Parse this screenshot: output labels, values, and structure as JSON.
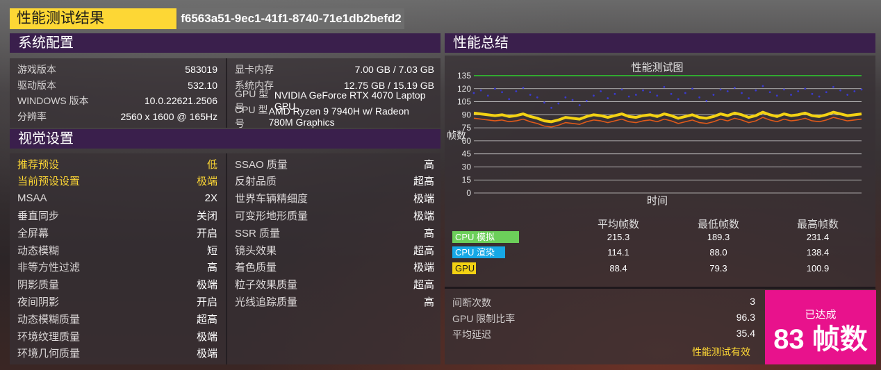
{
  "header": {
    "title": "性能测试结果",
    "run_id": "f6563a51-9ec1-41f1-8740-71e1db2befd2"
  },
  "system": {
    "title": "系统配置",
    "left": [
      {
        "label": "游戏版本",
        "value": "583019"
      },
      {
        "label": "驱动版本",
        "value": "532.10"
      },
      {
        "label": "WINDOWS 版本",
        "value": "10.0.22621.2506"
      },
      {
        "label": "分辨率",
        "value": "2560 x 1600 @ 165Hz"
      }
    ],
    "right": [
      {
        "label": "显卡内存",
        "value": "7.00 GB / 7.03 GB"
      },
      {
        "label": "系统内存",
        "value": "12.75 GB / 15.19 GB"
      },
      {
        "label": "GPU 型号",
        "value": "NVIDIA GeForce RTX 4070 Laptop GPU"
      },
      {
        "label": "CPU 型号",
        "value": "AMD Ryzen 9 7940H  w/ Radeon 780M Graphics"
      }
    ]
  },
  "visual": {
    "title": "视觉设置",
    "left": [
      {
        "label": "推荐预设",
        "value": "低",
        "highlight": true
      },
      {
        "label": "当前预设设置",
        "value": "极端",
        "highlight": true
      },
      {
        "label": "MSAA",
        "value": "2X"
      },
      {
        "label": "垂直同步",
        "value": "关闭"
      },
      {
        "label": "全屏幕",
        "value": "开启"
      },
      {
        "label": "动态模糊",
        "value": "短"
      },
      {
        "label": "非等方性过滤",
        "value": "高"
      },
      {
        "label": "阴影质量",
        "value": "极端"
      },
      {
        "label": "夜间阴影",
        "value": "开启"
      },
      {
        "label": "动态模糊质量",
        "value": "超高"
      },
      {
        "label": "环境纹理质量",
        "value": "极端"
      },
      {
        "label": "环境几何质量",
        "value": "极端"
      }
    ],
    "right": [
      {
        "label": "SSAO 质量",
        "value": "高"
      },
      {
        "label": "反射品质",
        "value": "超高"
      },
      {
        "label": "世界车辆精细度",
        "value": "极端"
      },
      {
        "label": "可变形地形质量",
        "value": "极端"
      },
      {
        "label": "SSR 质量",
        "value": "高"
      },
      {
        "label": "镜头效果",
        "value": "超高"
      },
      {
        "label": "着色质量",
        "value": "极端"
      },
      {
        "label": "粒子效果质量",
        "value": "超高"
      },
      {
        "label": "光线追踪质量",
        "value": "高"
      }
    ]
  },
  "summary": {
    "title": "性能总结",
    "columns": [
      "平均帧数",
      "最低帧数",
      "最高帧数"
    ],
    "rows": [
      {
        "tag": "CPU 模拟",
        "color": "#6ccf5a",
        "values": [
          "215.3",
          "189.3",
          "231.4"
        ]
      },
      {
        "tag": "CPU 渲染",
        "color": "#16a8e6",
        "values": [
          "114.1",
          "88.0",
          "138.4"
        ]
      },
      {
        "tag": "GPU",
        "color": "#f3d213",
        "values": [
          "88.4",
          "79.3",
          "100.9"
        ]
      }
    ],
    "bottom": [
      {
        "label": "间断次数",
        "value": "3"
      },
      {
        "label": "GPU 限制比率",
        "value": "96.3"
      },
      {
        "label": "平均延迟",
        "value": "35.4"
      }
    ],
    "valid_text": "性能测试有效",
    "achieved_sub": "已达成",
    "achieved_main": "83 帧数"
  },
  "chart_data": {
    "type": "line",
    "title": "性能测试图",
    "xlabel": "时间",
    "ylabel": "帧数",
    "ylim": [
      0,
      135
    ],
    "yticks": [
      0,
      15,
      30,
      45,
      60,
      75,
      90,
      105,
      120,
      135
    ],
    "grid": true,
    "series": [
      {
        "color": "#3a3acf",
        "style": "points",
        "values": [
          115,
          118,
          112,
          120,
          116,
          108,
          117,
          121,
          113,
          110,
          104,
          98,
          103,
          110,
          107,
          101,
          106,
          112,
          117,
          109,
          114,
          119,
          111,
          113,
          118,
          116,
          112,
          122,
          114,
          108,
          115,
          120,
          110,
          106,
          113,
          119,
          117,
          121,
          115,
          109,
          118,
          123,
          116,
          112,
          119,
          113,
          117,
          120,
          114,
          111,
          116,
          122,
          118,
          113,
          117,
          119
        ]
      },
      {
        "color": "#f3d213",
        "style": "band",
        "values": [
          92,
          91,
          90,
          89,
          90,
          88,
          89,
          91,
          88,
          86,
          83,
          82,
          84,
          87,
          86,
          85,
          88,
          90,
          89,
          87,
          89,
          91,
          88,
          87,
          89,
          90,
          88,
          91,
          89,
          86,
          88,
          90,
          87,
          86,
          88,
          91,
          89,
          92,
          90,
          87,
          89,
          93,
          90,
          88,
          91,
          89,
          90,
          92,
          89,
          88,
          90,
          93,
          91,
          89,
          90,
          91
        ]
      },
      {
        "color": "#e05a1a",
        "style": "line",
        "values": [
          86,
          85,
          84,
          83,
          84,
          82,
          83,
          85,
          82,
          80,
          77,
          76,
          78,
          81,
          80,
          79,
          82,
          84,
          83,
          81,
          83,
          85,
          82,
          81,
          83,
          84,
          82,
          85,
          83,
          80,
          82,
          84,
          81,
          80,
          82,
          85,
          83,
          86,
          84,
          81,
          83,
          87,
          84,
          82,
          85,
          83,
          84,
          86,
          83,
          82,
          84,
          87,
          85,
          83,
          84,
          85
        ]
      },
      {
        "color": "#2ed12e",
        "style": "line",
        "values": [
          135,
          135
        ]
      }
    ]
  }
}
